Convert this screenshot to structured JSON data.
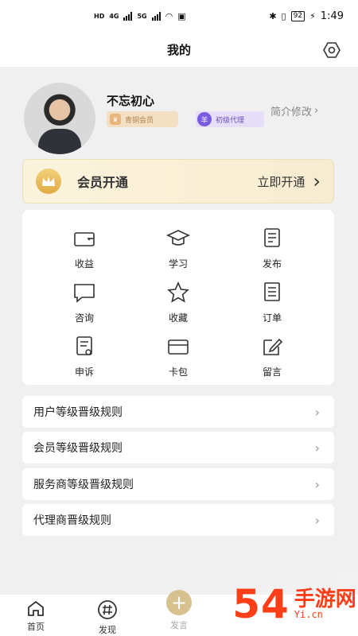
{
  "statusbar": {
    "left_small": "HD",
    "network_a": "4G",
    "network_b": "5G",
    "battery": "92",
    "time": "1:49"
  },
  "navbar": {
    "title": "我的",
    "settings_icon": "settings-icon"
  },
  "profile": {
    "name": "不忘初心",
    "badge_bronze": "青铜会员",
    "badge_agent": "初级代理",
    "edit_label": "简介修改"
  },
  "vip": {
    "title": "会员开通",
    "action": "立即开通"
  },
  "grid": [
    {
      "label": "收益",
      "icon": "wallet-icon"
    },
    {
      "label": "学习",
      "icon": "graduation-cap-icon"
    },
    {
      "label": "发布",
      "icon": "publish-icon"
    },
    {
      "label": "咨询",
      "icon": "chat-icon"
    },
    {
      "label": "收藏",
      "icon": "star-icon"
    },
    {
      "label": "订单",
      "icon": "order-list-icon"
    },
    {
      "label": "申诉",
      "icon": "appeal-icon"
    },
    {
      "label": "卡包",
      "icon": "card-icon"
    },
    {
      "label": "留言",
      "icon": "message-edit-icon"
    }
  ],
  "rules": [
    "用户等级晋级规则",
    "会员等级晋级规则",
    "服务商等级晋级规则",
    "代理商晋级规则"
  ],
  "tabs": [
    {
      "label": "首页",
      "icon": "home-icon"
    },
    {
      "label": "发现",
      "icon": "hashtag-icon"
    },
    {
      "label": "发言",
      "icon": "plus-icon"
    },
    {
      "label": "",
      "icon": "hidden-tab"
    },
    {
      "label": "",
      "icon": "hidden-tab"
    }
  ],
  "watermark": {
    "main": "54",
    "sub": "手游网",
    "url": "Yi.cn"
  },
  "colors": {
    "accent_gold": "#d7c18f",
    "vip_background": "#fbf3dc",
    "page_background": "#f0f0f0"
  }
}
